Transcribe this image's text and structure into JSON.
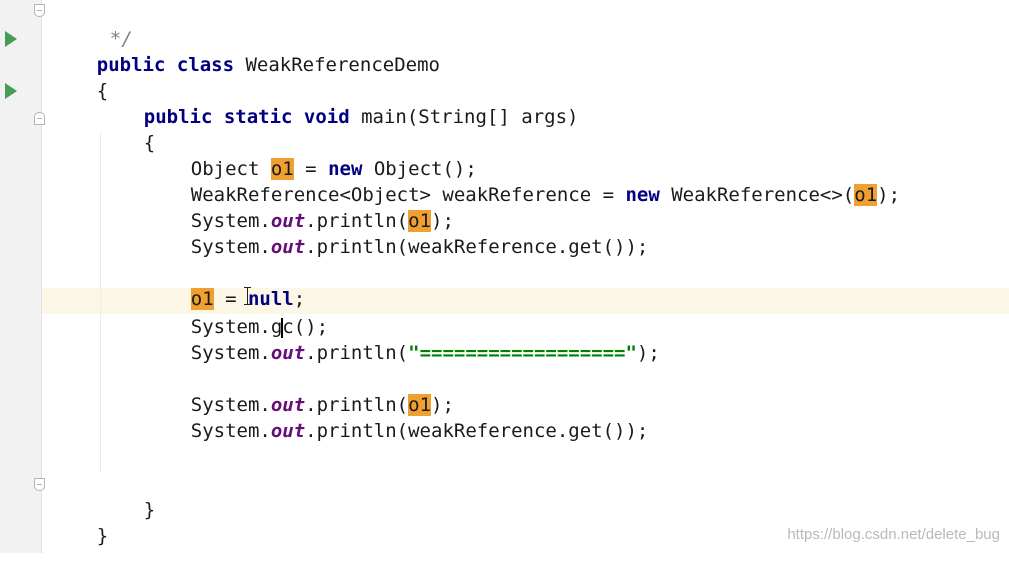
{
  "editor": {
    "lines": {
      "comment_end": "*/",
      "l1_kw": "public class",
      "l1_rest": " WeakReferenceDemo",
      "l2": "{",
      "l3_kw": "public static void",
      "l3_rest": " main(String[] args)",
      "l4": "{",
      "l5_a": "Object ",
      "l5_var": "o1",
      "l5_b": " = ",
      "l5_kw": "new",
      "l5_c": " Object();",
      "l6_a": "WeakReference<Object> weakReference = ",
      "l6_kw": "new",
      "l6_b": " WeakReference<>(",
      "l6_var": "o1",
      "l6_c": ");",
      "l7_a": "System.",
      "l7_out": "out",
      "l7_b": ".println(",
      "l7_var": "o1",
      "l7_c": ");",
      "l8_a": "System.",
      "l8_out": "out",
      "l8_b": ".println(weakReference.get());",
      "l9_var": "o1",
      "l9_a": " = ",
      "l9_kw": "null",
      "l9_b": ";",
      "l10_a": "System.g",
      "l10_b": "c();",
      "l11_a": "System.",
      "l11_out": "out",
      "l11_b": ".println(",
      "l11_str": "\"==================\"",
      "l11_c": ");",
      "l12_a": "System.",
      "l12_out": "out",
      "l12_b": ".println(",
      "l12_var": "o1",
      "l12_c": ");",
      "l13_a": "System.",
      "l13_out": "out",
      "l13_b": ".println(weakReference.get());",
      "l14": "}",
      "l15": "}"
    },
    "gutter_icons": [
      "run-icon",
      "run-icon",
      "fold-icon",
      "fold-icon",
      "fold-icon"
    ],
    "colors": {
      "keyword": "#000080",
      "static_field": "#660e7a",
      "string": "#008000",
      "usage_highlight": "#f0a030",
      "caret_row": "#fbf6e6",
      "run_icon": "#499c54"
    }
  },
  "watermark": "https://blog.csdn.net/delete_bug"
}
